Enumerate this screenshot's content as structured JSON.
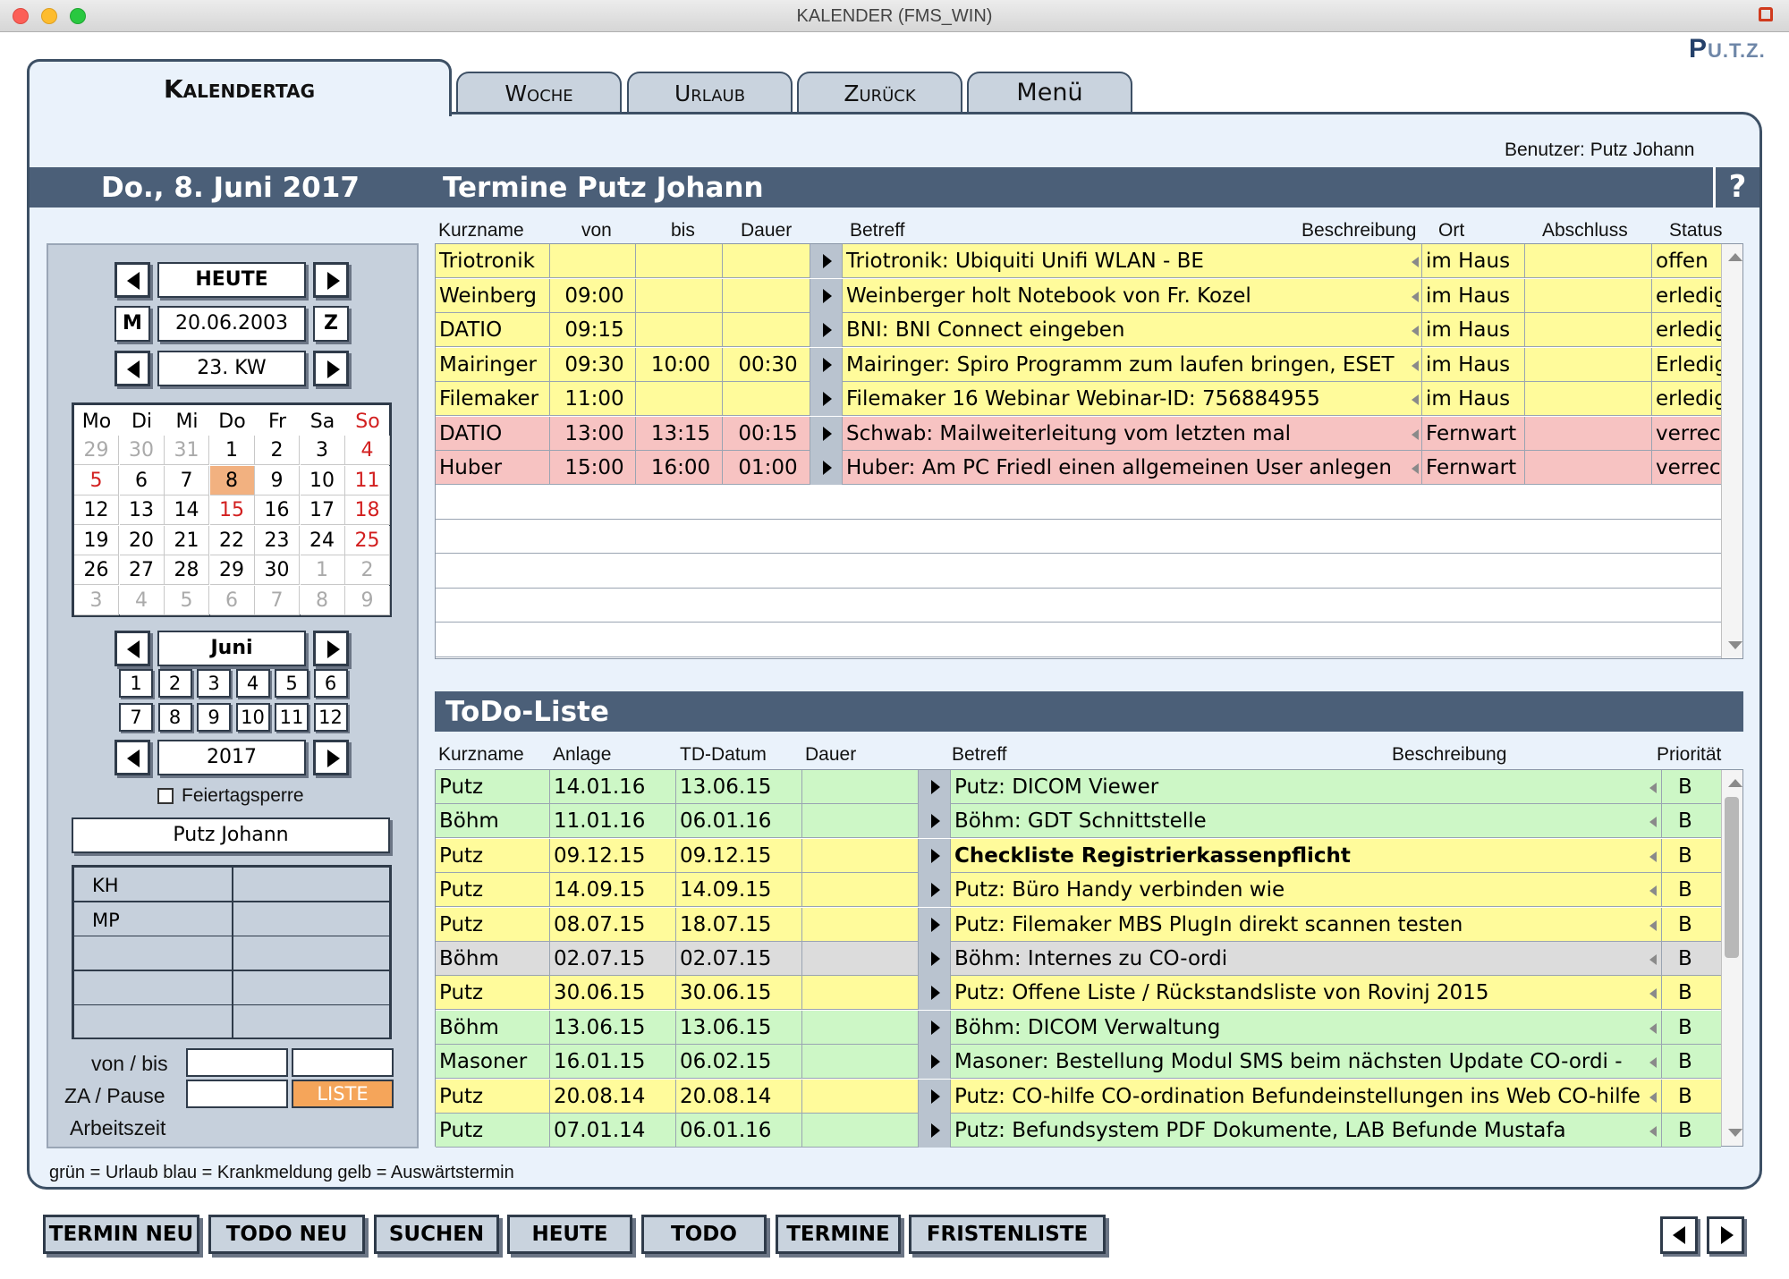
{
  "window": {
    "title": "KALENDER (FMS_WIN)"
  },
  "logo": {
    "main": "P",
    "rest": "U.T.Z."
  },
  "tabs": {
    "active": "Kalendertag",
    "woche": "Woche",
    "urlaub": "Urlaub",
    "zurueck": "Zurück",
    "menu": "Menü"
  },
  "user_line": "Benutzer: Putz Johann",
  "header": {
    "date": "Do., 8. Juni 2017",
    "title": "Termine Putz Johann",
    "help": "?"
  },
  "sidebar": {
    "today_label": "HEUTE",
    "m_label": "M",
    "z_label": "Z",
    "date_value": "20.06.2003",
    "week_label": "23. KW",
    "month_label": "Juni",
    "year_label": "2017",
    "feiertag_label": "Feiertagsperre",
    "person": "Putz Johann",
    "emp_rows": [
      "KH",
      "MP",
      "",
      "",
      ""
    ],
    "vonbis_label": "von / bis",
    "za_label": "ZA / Pause",
    "liste_label": "LISTE",
    "arbeitszeit_label": "Arbeitszeit",
    "month_buttons": [
      "1",
      "2",
      "3",
      "4",
      "5",
      "6",
      "7",
      "8",
      "9",
      "10",
      "11",
      "12"
    ]
  },
  "calendar": {
    "weekdays": [
      "Mo",
      "Di",
      "Mi",
      "Do",
      "Fr",
      "Sa",
      "So"
    ],
    "weeks": [
      [
        "29",
        "30",
        "31",
        "1",
        "2",
        "3",
        "4"
      ],
      [
        "5",
        "6",
        "7",
        "8",
        "9",
        "10",
        "11"
      ],
      [
        "12",
        "13",
        "14",
        "15",
        "16",
        "17",
        "18"
      ],
      [
        "19",
        "20",
        "21",
        "22",
        "23",
        "24",
        "25"
      ],
      [
        "26",
        "27",
        "28",
        "29",
        "30",
        "1",
        "2"
      ],
      [
        "3",
        "4",
        "5",
        "6",
        "7",
        "8",
        "9"
      ]
    ]
  },
  "termine": {
    "columns": [
      "Kurzname",
      "von",
      "bis",
      "Dauer",
      "Betreff",
      "Beschreibung",
      "Ort",
      "Abschluss",
      "Status"
    ],
    "rows": [
      {
        "kurz": "Triotronik",
        "von": "",
        "bis": "",
        "dauer": "",
        "betreff": "Triotronik: Ubiquiti Unifi WLAN - BE",
        "ort": "im Haus",
        "abschluss": "",
        "status": "offen",
        "color": "yellow"
      },
      {
        "kurz": "Weinberg",
        "von": "09:00",
        "bis": "",
        "dauer": "",
        "betreff": "Weinberger holt Notebook von Fr. Kozel",
        "ort": "im Haus",
        "abschluss": "",
        "status": "erledigt",
        "color": "yellow"
      },
      {
        "kurz": "DATIO",
        "von": "09:15",
        "bis": "",
        "dauer": "",
        "betreff": "BNI: BNI Connect eingeben",
        "ort": "im Haus",
        "abschluss": "",
        "status": "erledigt",
        "color": "yellow"
      },
      {
        "kurz": "Mairinger",
        "von": "09:30",
        "bis": "10:00",
        "dauer": "00:30",
        "betreff": "Mairinger: Spiro Programm zum laufen bringen, ESET",
        "ort": "im Haus",
        "abschluss": "",
        "status": "Erledigt",
        "color": "yellow"
      },
      {
        "kurz": "Filemaker",
        "von": "11:00",
        "bis": "",
        "dauer": "",
        "betreff": "Filemaker 16 Webinar Webinar-ID: 756884955",
        "ort": "im Haus",
        "abschluss": "",
        "status": "erledigt",
        "color": "yellow"
      },
      {
        "kurz": "DATIO",
        "von": "13:00",
        "bis": "13:15",
        "dauer": "00:15",
        "betreff": "Schwab: Mailweiterleitung vom letzten mal",
        "ort": "Fernwart",
        "abschluss": "",
        "status": "verrechnet",
        "color": "pink"
      },
      {
        "kurz": "Huber",
        "von": "15:00",
        "bis": "16:00",
        "dauer": "01:00",
        "betreff": "Huber: Am PC Friedl einen allgemeinen User anlegen",
        "ort": "Fernwart",
        "abschluss": "",
        "status": "verrechnet",
        "color": "pink"
      }
    ]
  },
  "todo": {
    "title": "ToDo-Liste",
    "columns": [
      "Kurzname",
      "Anlage",
      "TD-Datum",
      "Dauer",
      "Betreff",
      "Beschreibung",
      "Priorität"
    ],
    "rows": [
      {
        "kurz": "Putz",
        "anlage": "14.01.16",
        "td": "13.06.15",
        "dauer": "",
        "betreff": "Putz: DICOM Viewer",
        "prio": "B",
        "color": "green",
        "bold": false
      },
      {
        "kurz": "Böhm",
        "anlage": "11.01.16",
        "td": "06.01.16",
        "dauer": "",
        "betreff": "Böhm: GDT Schnittstelle",
        "prio": "B",
        "color": "green",
        "bold": false
      },
      {
        "kurz": "Putz",
        "anlage": "09.12.15",
        "td": "09.12.15",
        "dauer": "",
        "betreff": "Checkliste Registrierkassenpflicht",
        "prio": "B",
        "color": "yellow",
        "bold": true
      },
      {
        "kurz": "Putz",
        "anlage": "14.09.15",
        "td": "14.09.15",
        "dauer": "",
        "betreff": "Putz: Büro Handy verbinden wie",
        "prio": "B",
        "color": "yellow",
        "bold": false
      },
      {
        "kurz": "Putz",
        "anlage": "08.07.15",
        "td": "18.07.15",
        "dauer": "",
        "betreff": "Putz: Filemaker MBS PlugIn direkt scannen testen",
        "prio": "B",
        "color": "yellow",
        "bold": false
      },
      {
        "kurz": "Böhm",
        "anlage": "02.07.15",
        "td": "02.07.15",
        "dauer": "",
        "betreff": "Böhm: Internes zu CO-ordi",
        "prio": "B",
        "color": "gray",
        "bold": false
      },
      {
        "kurz": "Putz",
        "anlage": "30.06.15",
        "td": "30.06.15",
        "dauer": "",
        "betreff": "Putz: Offene Liste / Rückstandsliste von Rovinj 2015",
        "prio": "B",
        "color": "yellow",
        "bold": false
      },
      {
        "kurz": "Böhm",
        "anlage": "13.06.15",
        "td": "13.06.15",
        "dauer": "",
        "betreff": "Böhm: DICOM Verwaltung",
        "prio": "B",
        "color": "green",
        "bold": false
      },
      {
        "kurz": "Masoner",
        "anlage": "16.01.15",
        "td": "06.02.15",
        "dauer": "",
        "betreff": "Masoner: Bestellung Modul SMS beim nächsten Update CO-ordi -",
        "prio": "B",
        "color": "green",
        "bold": false
      },
      {
        "kurz": "Putz",
        "anlage": "20.08.14",
        "td": "20.08.14",
        "dauer": "",
        "betreff": "Putz: CO-hilfe CO-ordination Befundeinstellungen ins Web CO-hilfe",
        "prio": "B",
        "color": "yellow",
        "bold": false
      },
      {
        "kurz": "Putz",
        "anlage": "07.01.14",
        "td": "06.01.16",
        "dauer": "",
        "betreff": "Putz: Befundsystem PDF Dokumente, LAB Befunde Mustafa",
        "prio": "B",
        "color": "green",
        "bold": false
      }
    ]
  },
  "legend": "grün = Urlaub blau = Krankmeldung gelb = Auswärtstermin",
  "buttons": [
    "TERMIN NEU",
    "TODO NEU",
    "SUCHEN",
    "HEUTE",
    "TODO",
    "TERMINE",
    "FRISTENLISTE"
  ],
  "colors": {
    "header_bar": "#4b5f78",
    "panel_bg": "#eaf2fb",
    "yellow": "#fffb9b",
    "pink": "#f7c3c2",
    "green": "#cdf7c6",
    "gray": "#dcdcdc",
    "selected_day": "#f2b180",
    "sunday_red": "#d21f1f"
  }
}
